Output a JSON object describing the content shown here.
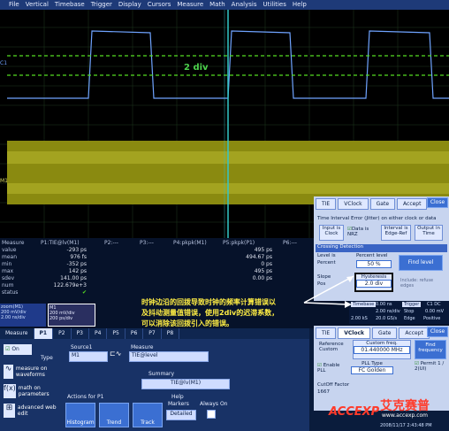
{
  "menu": [
    "File",
    "Vertical",
    "Timebase",
    "Trigger",
    "Display",
    "Cursors",
    "Measure",
    "Math",
    "Analysis",
    "Utilities",
    "Help"
  ],
  "overlay": {
    "div_label": "2 div",
    "c1_marker": "C1",
    "m1_marker": "M1"
  },
  "annotation": {
    "line1": "时钟边沿的回拨导致时钟的频率计算错误以",
    "line2": "及抖动测量值错误，使用2div的迟滞系数，",
    "line3": "可以消除该回拨引入的错误。"
  },
  "measure": {
    "row_labels": [
      "Measure",
      "value",
      "mean",
      "min",
      "max",
      "sdev",
      "num",
      "status"
    ],
    "columns": [
      {
        "header": "P1:TIE@lv(M1)",
        "values": [
          "-293 ps",
          "976 fs",
          "-352 ps",
          "142 ps",
          "141.00 ps",
          "122.679e+3",
          ""
        ]
      },
      {
        "header": "P2:---",
        "values": []
      },
      {
        "header": "P3:---",
        "values": []
      },
      {
        "header": "P4:pkpk(M1)",
        "values": []
      },
      {
        "header": "P5:pkpk(P1)",
        "values": [
          "495 ps",
          "494.67 ps",
          "0 ps",
          "495 ps",
          "0.00 ps",
          ""
        ]
      },
      {
        "header": "P6:---",
        "values": []
      }
    ]
  },
  "channels": {
    "c1": {
      "tag": "C1",
      "vdiv": "200 mV/div",
      "tdiv": "2.00 ns/div"
    },
    "m1": {
      "tag": "M1",
      "name": "zoom(M1)",
      "vdiv": "200 mV/div",
      "tdiv": "200 ps/div"
    }
  },
  "bottom": {
    "tabs": [
      "Measure",
      "P1",
      "P2",
      "P3",
      "P4",
      "P5",
      "P6",
      "P7",
      "P8"
    ],
    "on": "On",
    "type": "Type",
    "opt1": "measure on waveforms",
    "opt2": "math on parameters",
    "opt3": "advanced web edit",
    "source_label": "Source1",
    "source_value": "M1",
    "measure_label": "Measure",
    "measure_value": "TIE@level",
    "summary_label": "Summary",
    "summary_value": "TIE@lv(M1)",
    "actions": "Actions for P1",
    "help_label": "Help",
    "markers": "Markers",
    "always_on": "Always On",
    "detailed": "Detailed",
    "histogram": "Histogram",
    "trend": "Trend",
    "track": "Track"
  },
  "tie_dialog": {
    "tabs": [
      "TIE",
      "VClock",
      "Gate",
      "Accept"
    ],
    "close": "Close",
    "header": "Time Interval Error (Jitter) on either clock or data",
    "input_is": "Input is",
    "input_val": "Clock",
    "data_is_nrz": "Data is NRZ",
    "interval_is": "Interval is",
    "interval_val": "Edge-Ref",
    "output_in": "Output in",
    "output_val": "Time",
    "crossing": "Crossing Detection",
    "level_is": "Level is",
    "level_val": "Percent",
    "percent_level": "Percent level",
    "percent_val": "50 %",
    "find_level": "Find level",
    "slope": "Slope",
    "slope_val": "Pos",
    "hysteresis": "Hysteresis",
    "hyst_val": "2.0 div",
    "include": "Include: refuse edges"
  },
  "tb": {
    "timebase_label": "Timebase",
    "timebase_val": "0.00 ns",
    "trigger_label": "Trigger",
    "trigger_val": "C1 DC",
    "line1a": "2.00 ns/div",
    "line1b": "Stop",
    "line1c": "0.00 mV",
    "line2a": "2.00 kS",
    "line2b": "20.0 GS/s",
    "line2c": "Edge",
    "line2d": "Positive"
  },
  "vclock_dialog": {
    "tabs": [
      "TIE",
      "VClock",
      "Gate",
      "Accept"
    ],
    "close": "Close",
    "reference": "Reference",
    "reference_val": "Custom",
    "custom_freq": "Custom freq.",
    "freq_val": "01.440000 MHz",
    "find_frequency": "Find frequency",
    "enable_pll": "Enable PLL",
    "pll_type": "PLL Type",
    "pll_val": "FC Golden",
    "permit": "Permit 1 / 2(UI)",
    "cutoff": "CutOff Factor",
    "cutoff_val": "1667"
  },
  "logo": {
    "text": "ACCEXP",
    "cn": "艾克赛普",
    "url": "www.accexp.com"
  },
  "timestamp": "2008/11/17 2:43:48 PM",
  "colors": {
    "trace": "#6fa3ff",
    "level": "#55dd22",
    "band": "#8a8a10",
    "accent": "#3b6fd2"
  }
}
